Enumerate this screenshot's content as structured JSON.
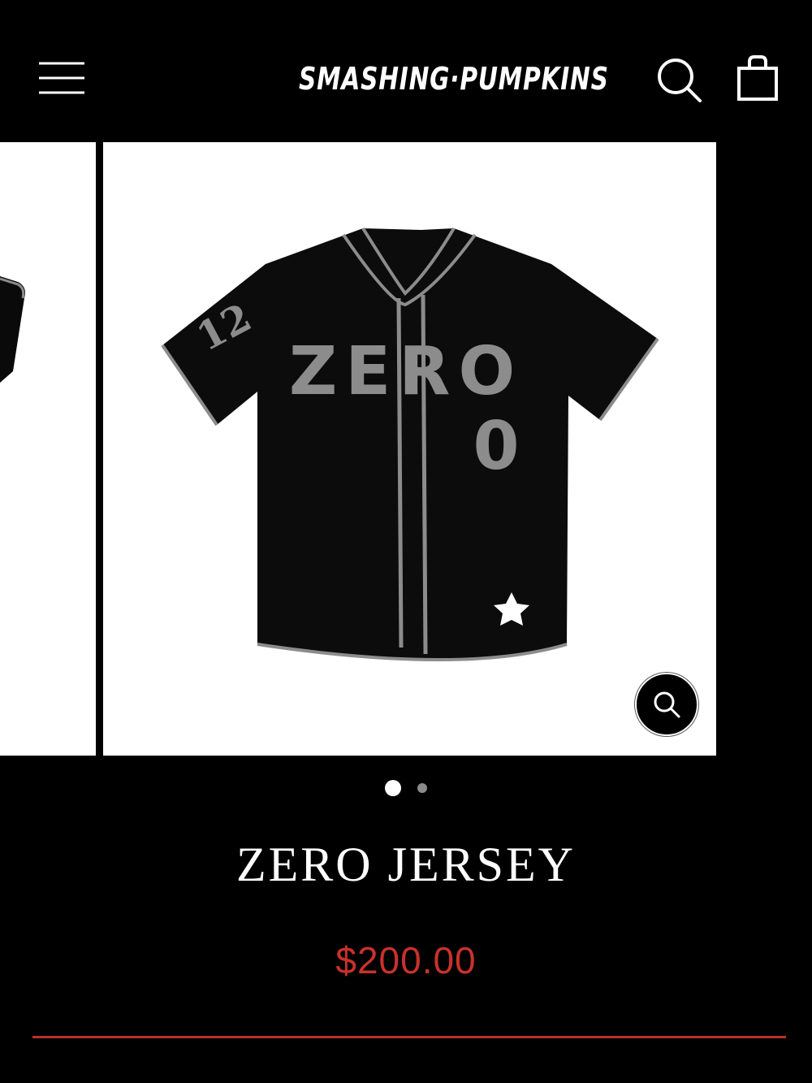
{
  "header": {
    "logo_text": "SMASHING·PUMPKINS",
    "menu_icon": "hamburger-menu-icon",
    "search_icon": "search-icon",
    "cart_icon": "shopping-bag-icon"
  },
  "gallery": {
    "main_image": {
      "jersey_text": "ZERO",
      "jersey_number": "0",
      "sleeve_number": "12"
    },
    "zoom_icon": "magnifier-icon",
    "slide_count": 2,
    "active_slide": 1
  },
  "product": {
    "title": "ZERO JERSEY",
    "price": "$200.00"
  },
  "colors": {
    "background": "#000000",
    "text": "#ffffff",
    "price": "#c8322b",
    "divider": "#b8302a",
    "jersey_trim": "#8c8c8c"
  }
}
